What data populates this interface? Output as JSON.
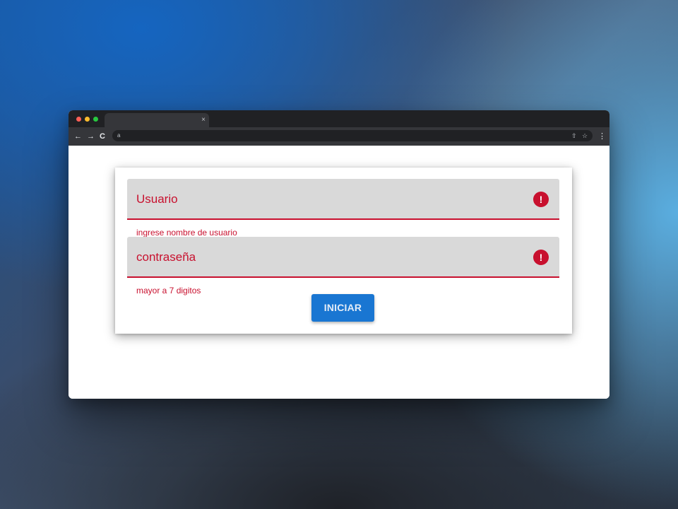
{
  "browser": {
    "tab_close": "×",
    "nav": {
      "back": "←",
      "forward": "→",
      "reload": "C"
    },
    "omnibox": {
      "lock": "a",
      "share": "⇧",
      "bookmark": "☆"
    },
    "menu": "⋮"
  },
  "form": {
    "username": {
      "label": "Usuario",
      "error_icon": "!",
      "helper": "ingrese nombre de usuario"
    },
    "password": {
      "label": "contraseña",
      "error_icon": "!",
      "helper": "mayor a 7 digitos"
    },
    "submit_label": "INICIAR"
  },
  "colors": {
    "error": "#c8102e",
    "primary": "#1976d2",
    "field_bg": "#d9d9d9"
  },
  "icons": [
    "close-icon",
    "back-icon",
    "forward-icon",
    "reload-icon",
    "lock-icon",
    "share-icon",
    "bookmark-icon",
    "menu-icon",
    "error-icon"
  ]
}
